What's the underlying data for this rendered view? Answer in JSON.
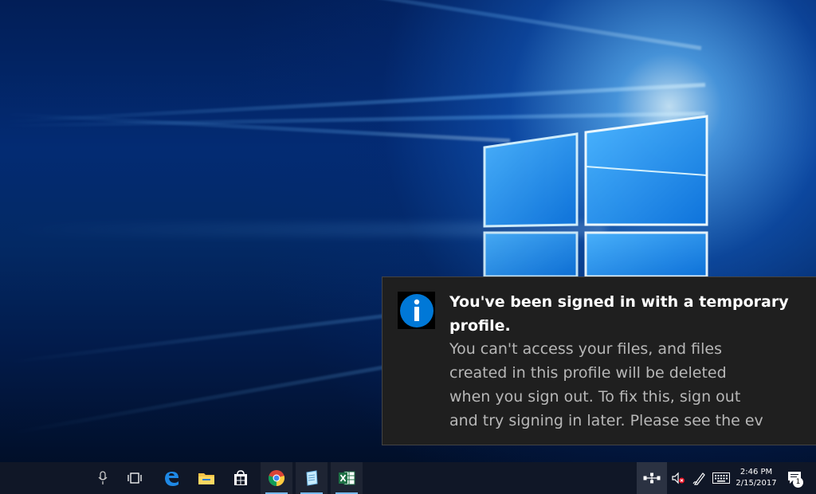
{
  "toast": {
    "icon": "info-icon",
    "title": "You've been signed in with a temporary profile.",
    "body": "You can't access your files, and files\ncreated in this profile will be deleted\nwhen you sign out. To fix this, sign out\nand try signing in later.  Please see the ev"
  },
  "taskbar": {
    "items": [
      {
        "icon": "microphone-icon"
      },
      {
        "icon": "task-view-icon"
      },
      {
        "icon": "edge-icon"
      },
      {
        "icon": "file-explorer-icon"
      },
      {
        "icon": "store-icon"
      },
      {
        "icon": "chrome-icon",
        "active": true
      },
      {
        "icon": "notepad-icon",
        "active": true
      },
      {
        "icon": "excel-icon",
        "active": true
      }
    ],
    "tray": {
      "network": "network-icon",
      "volume": "volume-muted-icon",
      "pen": "pen-ink-icon",
      "keyboard": "keyboard-icon",
      "time": "2:46 PM",
      "date": "2/15/2017",
      "notification_count": "1"
    }
  },
  "colors": {
    "accent": "#0078d7",
    "toast_background": "#1f1f1f",
    "taskbar": "#101727",
    "active_indicator": "#76b9ed"
  }
}
